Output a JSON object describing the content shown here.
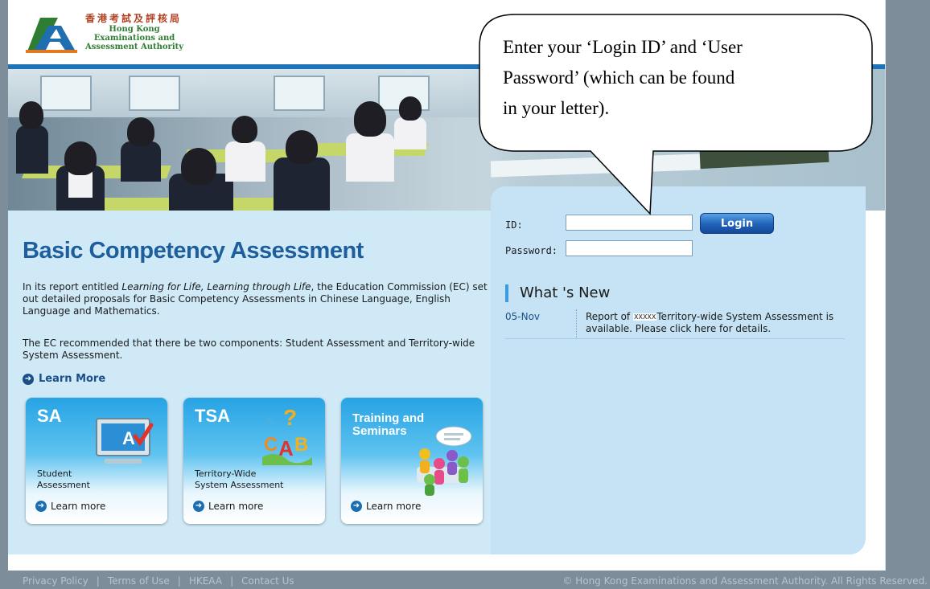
{
  "header": {
    "logo_cn": "香港考試及評核局",
    "logo_en_line1": "Hong Kong",
    "logo_en_line2": "Examinations and",
    "logo_en_line3": "Assessment Authority"
  },
  "main": {
    "title": "Basic Competency Assessment",
    "para1_pre": "In its report entitled ",
    "para1_em": "Learning for Life, Learning through Life",
    "para1_post": ", the Education Commission (EC) set out detailed proposals for Basic Competency Assessments in Chinese Language, English Language and Mathematics.",
    "para2": "The EC recommended that there be two components: Student Assessment and Territory-wide System Assessment.",
    "learn_more": "Learn More"
  },
  "cards": [
    {
      "title": "SA",
      "sub_line1": "Student",
      "sub_line2": "Assessment",
      "learn": "Learn more"
    },
    {
      "title": "TSA",
      "sub_line1": "Territory-Wide",
      "sub_line2": "System Assessment",
      "learn": "Learn more"
    },
    {
      "title_line1": "Training and",
      "title_line2": "Seminars",
      "learn": "Learn more"
    }
  ],
  "login": {
    "id_label": "ID:",
    "password_label": "Password:",
    "id_value": "",
    "password_value": "",
    "button": "Login"
  },
  "news": {
    "title": "What 's New",
    "items": [
      {
        "date": "05-Nov",
        "text_pre": "Report of ",
        "masked": "XXXXX",
        "text_post": "Territory-wide System Assessment is available. Please click here for details."
      }
    ]
  },
  "footer": {
    "links": [
      "Privacy Policy",
      "|",
      "Terms of Use",
      "|",
      "HKEAA",
      "|",
      "Contact Us"
    ],
    "copyright": "© Hong Kong Examinations and Assessment Authority. All Rights Reserved."
  },
  "callout": {
    "line1": "Enter your ‘Login ID’ and ‘User",
    "line2": "Password’ (which can be found",
    "line3": "in your letter)."
  },
  "colors": {
    "accent_blue": "#1f5e9c",
    "panel_blue": "#c5e3f4",
    "button_blue": "#1f63b8",
    "frame_gray": "#7d8e9a"
  }
}
